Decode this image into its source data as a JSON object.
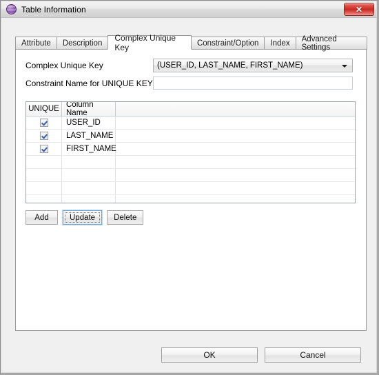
{
  "window": {
    "title": "Table Information",
    "icon": "sphere-icon",
    "close_label": "✕"
  },
  "tabs": [
    {
      "label": "Attribute",
      "active": false
    },
    {
      "label": "Description",
      "active": false
    },
    {
      "label": "Complex Unique Key",
      "active": true
    },
    {
      "label": "Constraint/Option",
      "active": false
    },
    {
      "label": "Index",
      "active": false
    },
    {
      "label": "Advanced Settings",
      "active": false
    }
  ],
  "form": {
    "complex_unique_key_label": "Complex Unique Key",
    "complex_unique_key_value": "(USER_ID, LAST_NAME, FIRST_NAME)",
    "constraint_name_label": "Constraint Name for UNIQUE KEY",
    "constraint_name_value": "",
    "constraint_name_placeholder": ""
  },
  "grid": {
    "headers": [
      "UNIQUE",
      "Column Name",
      ""
    ],
    "rows": [
      {
        "unique": true,
        "name": "USER_ID"
      },
      {
        "unique": true,
        "name": "LAST_NAME"
      },
      {
        "unique": true,
        "name": "FIRST_NAME"
      },
      {
        "unique": null,
        "name": ""
      },
      {
        "unique": null,
        "name": ""
      },
      {
        "unique": null,
        "name": ""
      },
      {
        "unique": null,
        "name": ""
      }
    ]
  },
  "row_buttons": [
    {
      "label": "Add",
      "focused": false
    },
    {
      "label": "Update",
      "focused": true
    },
    {
      "label": "Delete",
      "focused": false
    }
  ],
  "dialog_buttons": {
    "ok": "OK",
    "cancel": "Cancel"
  },
  "colors": {
    "accent": "#6ea8d8",
    "close": "#c52a22",
    "check": "#3a5fa8",
    "panel": "#ffffff",
    "chrome": "#f0f0f0"
  }
}
